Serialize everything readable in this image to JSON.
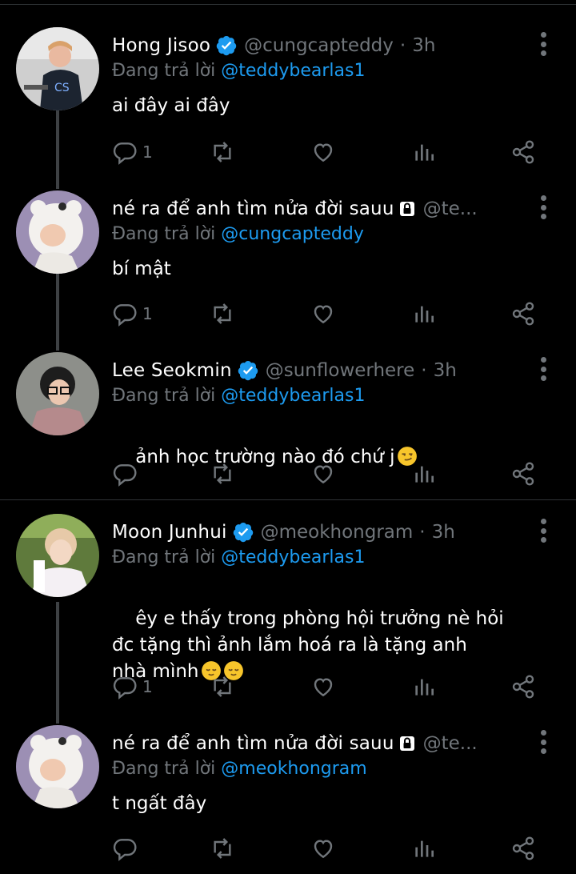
{
  "reply_prefix": "Đang trả lời",
  "tweets": [
    {
      "name": "Hong Jisoo",
      "verified": true,
      "locked": false,
      "handle": "@cungcapteddy",
      "separator": "·",
      "time": "3h",
      "reply_to": "@teddybearlas1",
      "text": "ai đây ai đây",
      "emoji": "",
      "reply_count": "1"
    },
    {
      "name": "né ra để anh tìm nửa đời sauu",
      "verified": false,
      "locked": true,
      "handle": "@te...",
      "separator": "",
      "time": "",
      "reply_to": "@cungcapteddy",
      "text": "bí mật",
      "emoji": "",
      "reply_count": "1"
    },
    {
      "name": "Lee Seokmin",
      "verified": true,
      "locked": false,
      "handle": "@sunflowerhere",
      "separator": "·",
      "time": "3h",
      "reply_to": "@teddybearlas1",
      "text": "ảnh học trường nào đó chứ j",
      "emoji": "smirk-emoji",
      "reply_count": ""
    },
    {
      "name": "Moon Junhui",
      "verified": true,
      "locked": false,
      "handle": "@meokhongram",
      "separator": "·",
      "time": "3h",
      "reply_to": "@teddybearlas1",
      "text": "êy e thấy trong phòng hội trưởng nè hỏi\nđc tặng thì ảnh lắm hoá ra là tặng anh\nnhà mình",
      "emoji": "relieved-emoji relieved-emoji",
      "reply_count": "1"
    },
    {
      "name": "né ra để anh tìm nửa đời sauu",
      "verified": false,
      "locked": true,
      "handle": "@te...",
      "separator": "",
      "time": "",
      "reply_to": "@meokhongram",
      "text": "t ngất đây",
      "emoji": "",
      "reply_count": ""
    }
  ],
  "colors": {
    "background": "#000000",
    "text": "#ffffff",
    "muted": "#71767b",
    "accent": "#1d9bf0",
    "thread_line": "#3e4144",
    "divider": "#2f3336"
  },
  "icons": [
    "reply-icon",
    "retweet-icon",
    "like-icon",
    "views-icon",
    "share-icon",
    "more-icon",
    "verified-icon",
    "lock-icon"
  ]
}
